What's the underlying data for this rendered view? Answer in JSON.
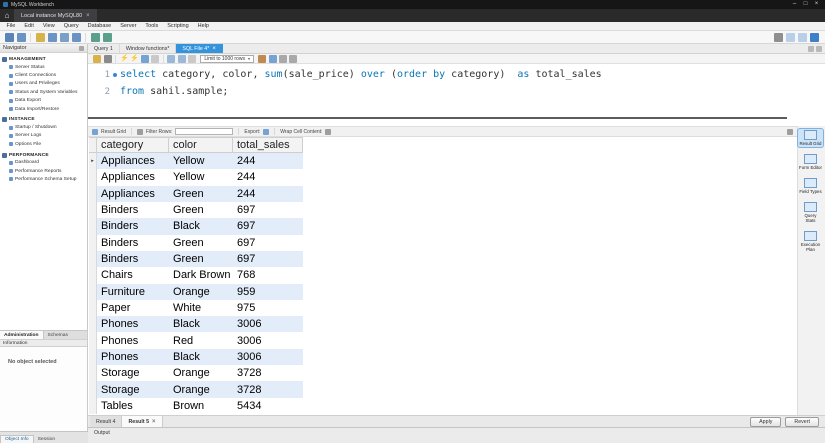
{
  "window": {
    "title": "MySQL Workbench",
    "controls": {
      "minimize": "–",
      "maximize": "□",
      "close": "×"
    }
  },
  "connection": {
    "tab_label": "Local instance MySQL80",
    "close": "×"
  },
  "ui": {
    "close_glyph": "×",
    "caret_glyph": "▾",
    "row_marker_glyph": "▸",
    "home_glyph": "⌂"
  },
  "menu": {
    "items": [
      "File",
      "Edit",
      "View",
      "Query",
      "Database",
      "Server",
      "Tools",
      "Scripting",
      "Help"
    ]
  },
  "toolbar": {
    "left_icons": [
      {
        "name": "new-connection-icon",
        "bg": "#5b84b8"
      },
      {
        "name": "new-sql-tab-icon",
        "bg": "#6b94c4"
      },
      {
        "sep": true
      },
      {
        "name": "open-script-icon",
        "bg": "#d8b24a"
      },
      {
        "name": "create-schema-icon",
        "bg": "#6b94c4"
      },
      {
        "name": "create-table-icon",
        "bg": "#7aa0c8"
      },
      {
        "name": "create-view-icon",
        "bg": "#6b94c4"
      },
      {
        "sep": true
      },
      {
        "name": "data-export-icon",
        "bg": "#5aa08a"
      },
      {
        "name": "data-import-icon",
        "bg": "#5aa08a"
      }
    ],
    "right_icons": [
      {
        "name": "preferences-gear-icon",
        "bg": "#8f8f8f"
      },
      {
        "name": "panel-left-toggle-icon",
        "bg": "#b9cfe8"
      },
      {
        "name": "panel-bottom-toggle-icon",
        "bg": "#b9cfe8"
      },
      {
        "name": "panel-right-toggle-icon",
        "bg": "#3f7fc9"
      }
    ]
  },
  "navigator": {
    "title": "Navigator",
    "sections": [
      {
        "title": "MANAGEMENT",
        "icon": "management-icon",
        "items": [
          {
            "label": "Server Status",
            "icon": "server-status-icon"
          },
          {
            "label": "Client Connections",
            "icon": "client-connections-icon"
          },
          {
            "label": "Users and Privileges",
            "icon": "users-privileges-icon"
          },
          {
            "label": "Status and System Variables",
            "icon": "system-variables-icon"
          },
          {
            "label": "Data Export",
            "icon": "data-export-icon"
          },
          {
            "label": "Data Import/Restore",
            "icon": "data-import-icon"
          }
        ]
      },
      {
        "title": "INSTANCE",
        "icon": "instance-icon",
        "items": [
          {
            "label": "Startup / Shutdown",
            "icon": "startup-shutdown-icon"
          },
          {
            "label": "Server Logs",
            "icon": "server-logs-icon"
          },
          {
            "label": "Options File",
            "icon": "options-file-icon"
          }
        ]
      },
      {
        "title": "PERFORMANCE",
        "icon": "performance-icon",
        "items": [
          {
            "label": "Dashboard",
            "icon": "dashboard-icon"
          },
          {
            "label": "Performance Reports",
            "icon": "performance-reports-icon"
          },
          {
            "label": "Performance Schema Setup",
            "icon": "performance-schema-setup-icon"
          }
        ]
      }
    ],
    "bottom_tabs": [
      {
        "label": "Administration"
      },
      {
        "label": "Schemas"
      }
    ],
    "information_title": "Information",
    "no_object_text": "No object selected"
  },
  "editor": {
    "tabs": [
      {
        "label": "Query 1",
        "active": false,
        "closable": false
      },
      {
        "label": "Window functions*",
        "active": false,
        "closable": false
      },
      {
        "label": "SQL File 4*",
        "active": true,
        "closable": true
      }
    ],
    "toolbar": {
      "icons_before": [
        {
          "name": "open-file-icon",
          "bg": "#d8b24a"
        },
        {
          "name": "save-file-icon",
          "bg": "#8a8a8a"
        },
        {
          "sep": true
        },
        {
          "name": "execute-icon",
          "glyph": "⚡",
          "color": "#e7a312"
        },
        {
          "name": "execute-current-icon",
          "glyph": "⚡",
          "color": "#c98f10"
        },
        {
          "name": "explain-icon",
          "bg": "#76a3d4"
        },
        {
          "name": "stop-icon",
          "bg": "#c9c9c9"
        },
        {
          "sep": true
        },
        {
          "name": "toggle-autocommit-icon",
          "bg": "#9bb8d8"
        },
        {
          "name": "commit-icon",
          "bg": "#9bb8d8"
        },
        {
          "name": "rollback-icon",
          "bg": "#c9c9c9"
        }
      ],
      "limit_label": "Limit to 1000 rows",
      "icons_after": [
        {
          "name": "beautify-icon",
          "bg": "#c08a50"
        },
        {
          "name": "find-icon",
          "bg": "#76a3d4"
        },
        {
          "name": "invisible-chars-icon",
          "bg": "#a9a9a9"
        },
        {
          "name": "wrap-text-icon",
          "bg": "#a9a9a9"
        }
      ]
    },
    "code_lines": [
      {
        "num": "1",
        "marker": true,
        "tokens": [
          [
            "kw",
            "select"
          ],
          [
            "pl",
            " category, color, "
          ],
          [
            "fn",
            "sum"
          ],
          [
            "pl",
            "(sale_price) "
          ],
          [
            "kw",
            "over"
          ],
          [
            "pl",
            " ("
          ],
          [
            "kw",
            "order by"
          ],
          [
            "pl",
            " category)  "
          ],
          [
            "kw",
            "as"
          ],
          [
            "pl",
            " total_sales"
          ]
        ]
      },
      {
        "num": "2",
        "marker": false,
        "tokens": [
          [
            "kw",
            "from"
          ],
          [
            "pl",
            " sahil.sample;"
          ]
        ]
      }
    ]
  },
  "result": {
    "toolbar": {
      "grid_label": "Result Grid",
      "filter_label": "Filter Rows:",
      "export_label": "Export:",
      "wrap_label": "Wrap Cell Content:",
      "icons": [
        "result-grid-icon",
        "filter-icon",
        "export-icon",
        "wrap-cell-content-icon"
      ]
    },
    "columns": [
      "category",
      "color",
      "total_sales"
    ],
    "rows": [
      [
        "Appliances",
        "Yellow",
        "244"
      ],
      [
        "Appliances",
        "Yellow",
        "244"
      ],
      [
        "Appliances",
        "Green",
        "244"
      ],
      [
        "Binders",
        "Green",
        "697"
      ],
      [
        "Binders",
        "Black",
        "697"
      ],
      [
        "Binders",
        "Green",
        "697"
      ],
      [
        "Binders",
        "Green",
        "697"
      ],
      [
        "Chairs",
        "Dark Brown",
        "768"
      ],
      [
        "Furniture",
        "Orange",
        "959"
      ],
      [
        "Paper",
        "White",
        "975"
      ],
      [
        "Phones",
        "Black",
        "3006"
      ],
      [
        "Phones",
        "Red",
        "3006"
      ],
      [
        "Phones",
        "Black",
        "3006"
      ],
      [
        "Storage",
        "Orange",
        "3728"
      ],
      [
        "Storage",
        "Orange",
        "3728"
      ],
      [
        "Tables",
        "Brown",
        "5434"
      ]
    ],
    "tabs": [
      {
        "label": "Result 4",
        "active": false,
        "closable": false
      },
      {
        "label": "Result 5",
        "active": true,
        "closable": true
      }
    ],
    "apply_label": "Apply",
    "revert_label": "Revert"
  },
  "right_panel": {
    "items": [
      {
        "label": "Result Grid",
        "icon": "result-grid-panel-icon",
        "active": true
      },
      {
        "label": "Form Editor",
        "icon": "form-editor-panel-icon",
        "active": false
      },
      {
        "label": "Field Types",
        "icon": "field-types-panel-icon",
        "active": false
      },
      {
        "label": "Query Stats",
        "icon": "query-stats-panel-icon",
        "active": false
      },
      {
        "label": "Execution Plan",
        "icon": "execution-plan-panel-icon",
        "active": false
      }
    ]
  },
  "output": {
    "label": "Output"
  },
  "statusbar": {
    "tabs": [
      {
        "label": "Object Info"
      },
      {
        "label": "Session"
      }
    ]
  },
  "colors": {
    "active_tab": "#3394db",
    "keyword": "#0a76b4",
    "row_stripe": "#e2edf9"
  }
}
